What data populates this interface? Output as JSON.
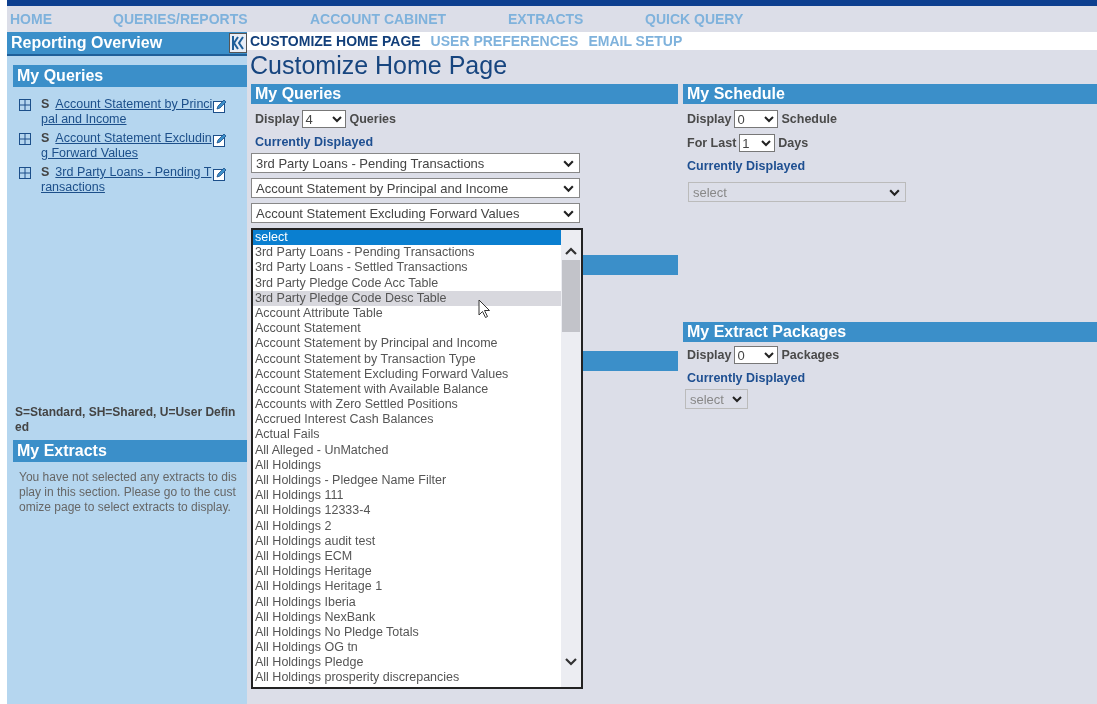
{
  "nav": [
    {
      "label": "HOME"
    },
    {
      "label": "QUERIES/REPORTS"
    },
    {
      "label": "ACCOUNT CABINET"
    },
    {
      "label": "EXTRACTS"
    },
    {
      "label": "QUICK QUERY"
    }
  ],
  "sidebar": {
    "title": "Reporting Overview",
    "my_queries": {
      "title": "My Queries",
      "items": [
        {
          "type": "S",
          "label": "Account Statement by Principal and Income"
        },
        {
          "type": "S",
          "label": "Account Statement Excluding Forward Values"
        },
        {
          "type": "S",
          "label": "3rd Party Loans - Pending Transactions"
        }
      ]
    },
    "legend": "S=Standard, SH=Shared, U=User Defined",
    "my_extracts": {
      "title": "My Extracts",
      "message": "You have not selected any extracts to display in this section. Please go to the customize page to select extracts to display."
    }
  },
  "sub_tabs": [
    {
      "label": "CUSTOMIZE HOME PAGE",
      "selected": true
    },
    {
      "label": "USER PREFERENCES",
      "selected": false
    },
    {
      "label": "EMAIL SETUP",
      "selected": false
    }
  ],
  "page_title": "Customize Home Page",
  "my_queries": {
    "title": "My Queries",
    "display_label": "Display",
    "display_value": "4",
    "unit": "Queries",
    "currently_displayed": "Currently Displayed",
    "selected_queries": [
      "3rd Party Loans - Pending Transactions",
      "Account Statement by Principal and Income",
      "Account Statement Excluding Forward Values"
    ],
    "open_list": [
      {
        "label": "select",
        "selected": true,
        "hovered": false
      },
      {
        "label": "3rd Party Loans - Pending Transactions",
        "selected": false,
        "hovered": false
      },
      {
        "label": "3rd Party Loans - Settled Transactions",
        "selected": false,
        "hovered": false
      },
      {
        "label": "3rd Party Pledge Code Acc Table",
        "selected": false,
        "hovered": false
      },
      {
        "label": "3rd Party Pledge Code Desc Table",
        "selected": false,
        "hovered": true
      },
      {
        "label": "Account Attribute Table",
        "selected": false,
        "hovered": false
      },
      {
        "label": "Account Statement",
        "selected": false,
        "hovered": false
      },
      {
        "label": "Account Statement by Principal and Income",
        "selected": false,
        "hovered": false
      },
      {
        "label": "Account Statement by Transaction Type",
        "selected": false,
        "hovered": false
      },
      {
        "label": "Account Statement Excluding Forward Values",
        "selected": false,
        "hovered": false
      },
      {
        "label": "Account Statement with Available Balance",
        "selected": false,
        "hovered": false
      },
      {
        "label": "Accounts with Zero Settled Positions",
        "selected": false,
        "hovered": false
      },
      {
        "label": "Accrued Interest Cash Balances",
        "selected": false,
        "hovered": false
      },
      {
        "label": "Actual Fails",
        "selected": false,
        "hovered": false
      },
      {
        "label": "All Alleged - UnMatched",
        "selected": false,
        "hovered": false
      },
      {
        "label": "All Holdings",
        "selected": false,
        "hovered": false
      },
      {
        "label": "All Holdings - Pledgee Name Filter",
        "selected": false,
        "hovered": false
      },
      {
        "label": "All Holdings 111",
        "selected": false,
        "hovered": false
      },
      {
        "label": "All Holdings 12333-4",
        "selected": false,
        "hovered": false
      },
      {
        "label": "All Holdings 2",
        "selected": false,
        "hovered": false
      },
      {
        "label": "All Holdings audit test",
        "selected": false,
        "hovered": false
      },
      {
        "label": "All Holdings ECM",
        "selected": false,
        "hovered": false
      },
      {
        "label": "All Holdings Heritage",
        "selected": false,
        "hovered": false
      },
      {
        "label": "All Holdings Heritage 1",
        "selected": false,
        "hovered": false
      },
      {
        "label": "All Holdings Iberia",
        "selected": false,
        "hovered": false
      },
      {
        "label": "All Holdings NexBank",
        "selected": false,
        "hovered": false
      },
      {
        "label": "All Holdings No Pledge Totals",
        "selected": false,
        "hovered": false
      },
      {
        "label": "All Holdings OG tn",
        "selected": false,
        "hovered": false
      },
      {
        "label": "All Holdings Pledge",
        "selected": false,
        "hovered": false
      },
      {
        "label": "All Holdings prosperity discrepancies",
        "selected": false,
        "hovered": false
      }
    ]
  },
  "my_schedule": {
    "title": "My Schedule",
    "display_label": "Display",
    "display_value": "0",
    "unit": "Schedule",
    "for_last_label": "For Last",
    "for_last_value": "1",
    "for_last_unit": "Days",
    "currently_displayed": "Currently Displayed",
    "select_value": "select"
  },
  "my_extract_packages": {
    "title": "My Extract Packages",
    "display_label": "Display",
    "display_value": "0",
    "unit": "Packages",
    "currently_displayed": "Currently Displayed",
    "select_value": "select"
  }
}
